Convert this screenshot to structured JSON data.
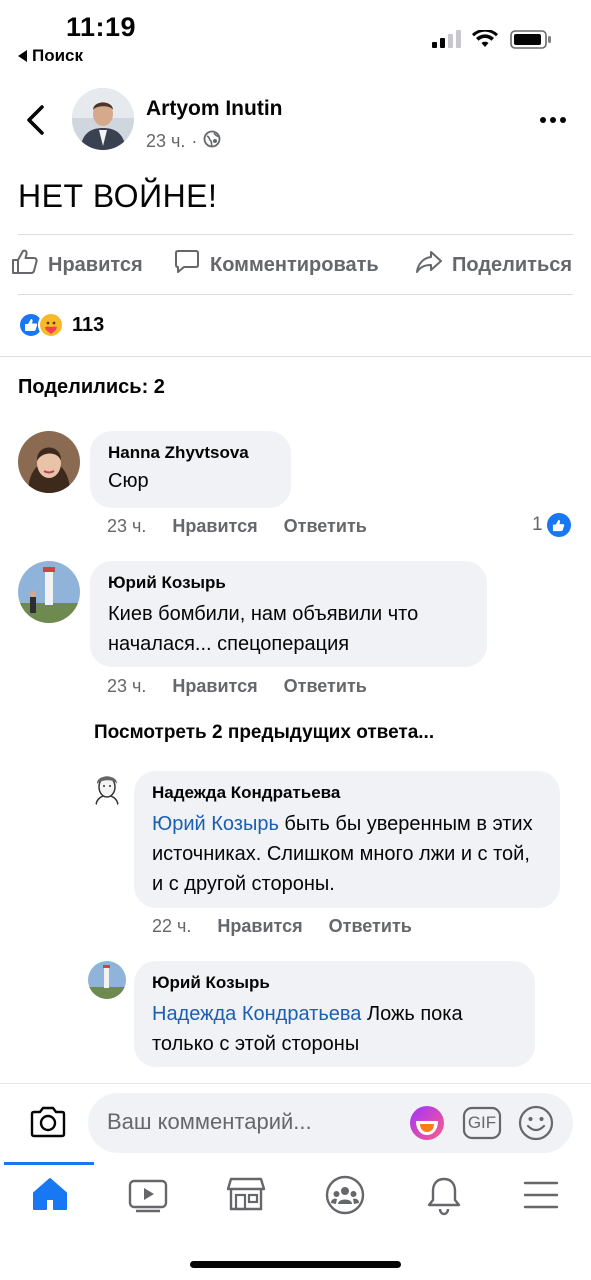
{
  "status_bar": {
    "time": "11:19",
    "back_app": "Поиск"
  },
  "post": {
    "author": "Artyom  Inutin",
    "time": "23 ч.",
    "text": "НЕТ  ВОЙНЕ!",
    "actions": {
      "like": "Нравится",
      "comment": "Комментировать",
      "share": "Поделиться"
    },
    "reactions_count": "113",
    "shared_label": "Поделились: 2"
  },
  "comments": [
    {
      "name": "Hanna Zhyvtsova",
      "text": "Сюр",
      "time": "23 ч.",
      "like_label": "Нравится",
      "reply_label": "Ответить",
      "likes": "1"
    },
    {
      "name": "Юрий Козырь",
      "text": "Киев бомбили, нам объявили что началася... спецоперация",
      "time": "23 ч.",
      "like_label": "Нравится",
      "reply_label": "Ответить"
    }
  ],
  "view_previous": "Посмотреть 2 предыдущих ответа...",
  "replies": [
    {
      "name": "Надежда Кондратьева",
      "mention": "Юрий Козырь",
      "text": " быть бы уверенным в этих источниках. Слишком много лжи и с той, и с другой стороны.",
      "time": "22 ч.",
      "like_label": "Нравится",
      "reply_label": "Ответить"
    },
    {
      "name": "Юрий Козырь",
      "mention": "Надежда Кондратьева",
      "text": " Ложь пока только с этой стороны"
    }
  ],
  "composer": {
    "placeholder": "Ваш комментарий...",
    "gif": "GIF"
  },
  "colors": {
    "accent": "#1877f2",
    "mention": "#1a5fb4",
    "bubble": "#f0f2f5",
    "secondary_text": "#65676b"
  },
  "icons": [
    "back-chevron-icon",
    "globe-icon",
    "more-icon",
    "like-outline-icon",
    "comment-icon",
    "share-icon",
    "camera-icon",
    "sticker-icon",
    "gif-icon",
    "emoji-icon",
    "home-icon",
    "video-icon",
    "marketplace-icon",
    "groups-icon",
    "bell-icon",
    "menu-icon"
  ]
}
